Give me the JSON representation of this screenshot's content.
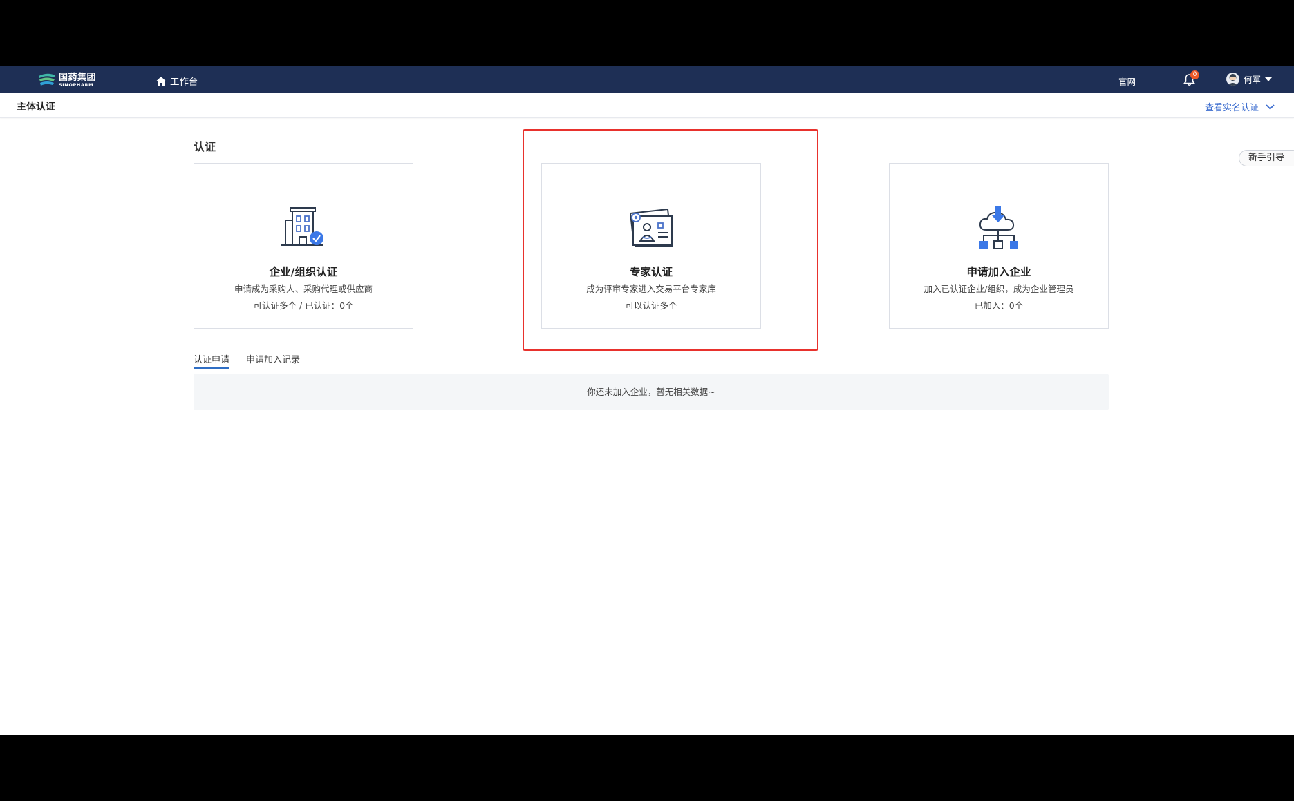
{
  "topbar": {
    "logo_cn": "国药集团",
    "logo_en": "SINOPHARM",
    "home_label": "工作台",
    "official_site": "官网",
    "notification_count": "0",
    "user_name": "何军"
  },
  "subheader": {
    "title": "主体认证",
    "view_realname": "查看实名认证"
  },
  "main": {
    "section_title": "认证",
    "guide_button": "新手引导",
    "cards": [
      {
        "title": "企业/组织认证",
        "desc": "申请成为采购人、采购代理或供应商",
        "sub": "可认证多个 / 已认证：0个",
        "icon": "building-verified-icon"
      },
      {
        "title": "专家认证",
        "desc": "成为评审专家进入交易平台专家库",
        "sub": "可以认证多个",
        "icon": "expert-id-card-icon"
      },
      {
        "title": "申请加入企业",
        "desc": "加入已认证企业/组织，成为企业管理员",
        "sub": "已加入：0个",
        "icon": "cloud-network-icon"
      }
    ],
    "tabs": [
      {
        "label": "认证申请",
        "active": true
      },
      {
        "label": "申请加入记录",
        "active": false
      }
    ],
    "empty_text": "你还未加入企业，暂无相关数据~"
  },
  "colors": {
    "topbar_bg": "#1e2f55",
    "accent_blue": "#3b6ccf",
    "highlight_red": "#e8322d",
    "badge": "#f05a28"
  }
}
